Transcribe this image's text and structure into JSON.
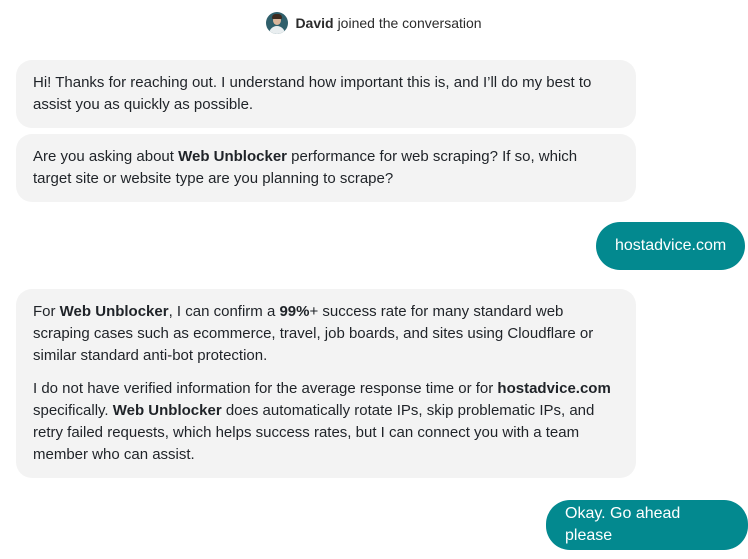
{
  "join_notice": {
    "avatar_icon": "user-avatar-icon",
    "name": "David",
    "text": "joined the conversation"
  },
  "messages": {
    "agent_1": {
      "text": "Hi! Thanks for reaching out. I understand how important this is, and I’ll do my best to assist you as quickly as possible."
    },
    "agent_2": {
      "pre": "Are you asking about ",
      "bold": "Web Unblocker",
      "post": " performance for web scraping? If so, which target site or website type are you planning to scrape?"
    },
    "user_1": {
      "text": "hostadvice.com"
    },
    "agent_3": {
      "p1_pre": "For ",
      "p1_bold1": "Web Unblocker",
      "p1_mid": ", I can confirm a ",
      "p1_bold2": "99%",
      "p1_post": "+ success rate for many standard web scraping cases such as ecommerce, travel, job boards, and sites using Cloudflare or similar standard anti-bot protection.",
      "p2_pre": "I do not have verified information for the average response time or for ",
      "p2_bold1": "hostadvice.com",
      "p2_mid": " specifically. ",
      "p2_bold2": "Web Unblocker",
      "p2_post": " does automatically rotate IPs, skip problematic IPs, and retry failed requests, which helps success rates, but I can connect you with a team member who can assist."
    },
    "user_2": {
      "text": "Okay. Go ahead please"
    }
  },
  "colors": {
    "agent_bubble": "#f3f3f3",
    "user_bubble": "#03898f",
    "user_text": "#ffffff"
  }
}
